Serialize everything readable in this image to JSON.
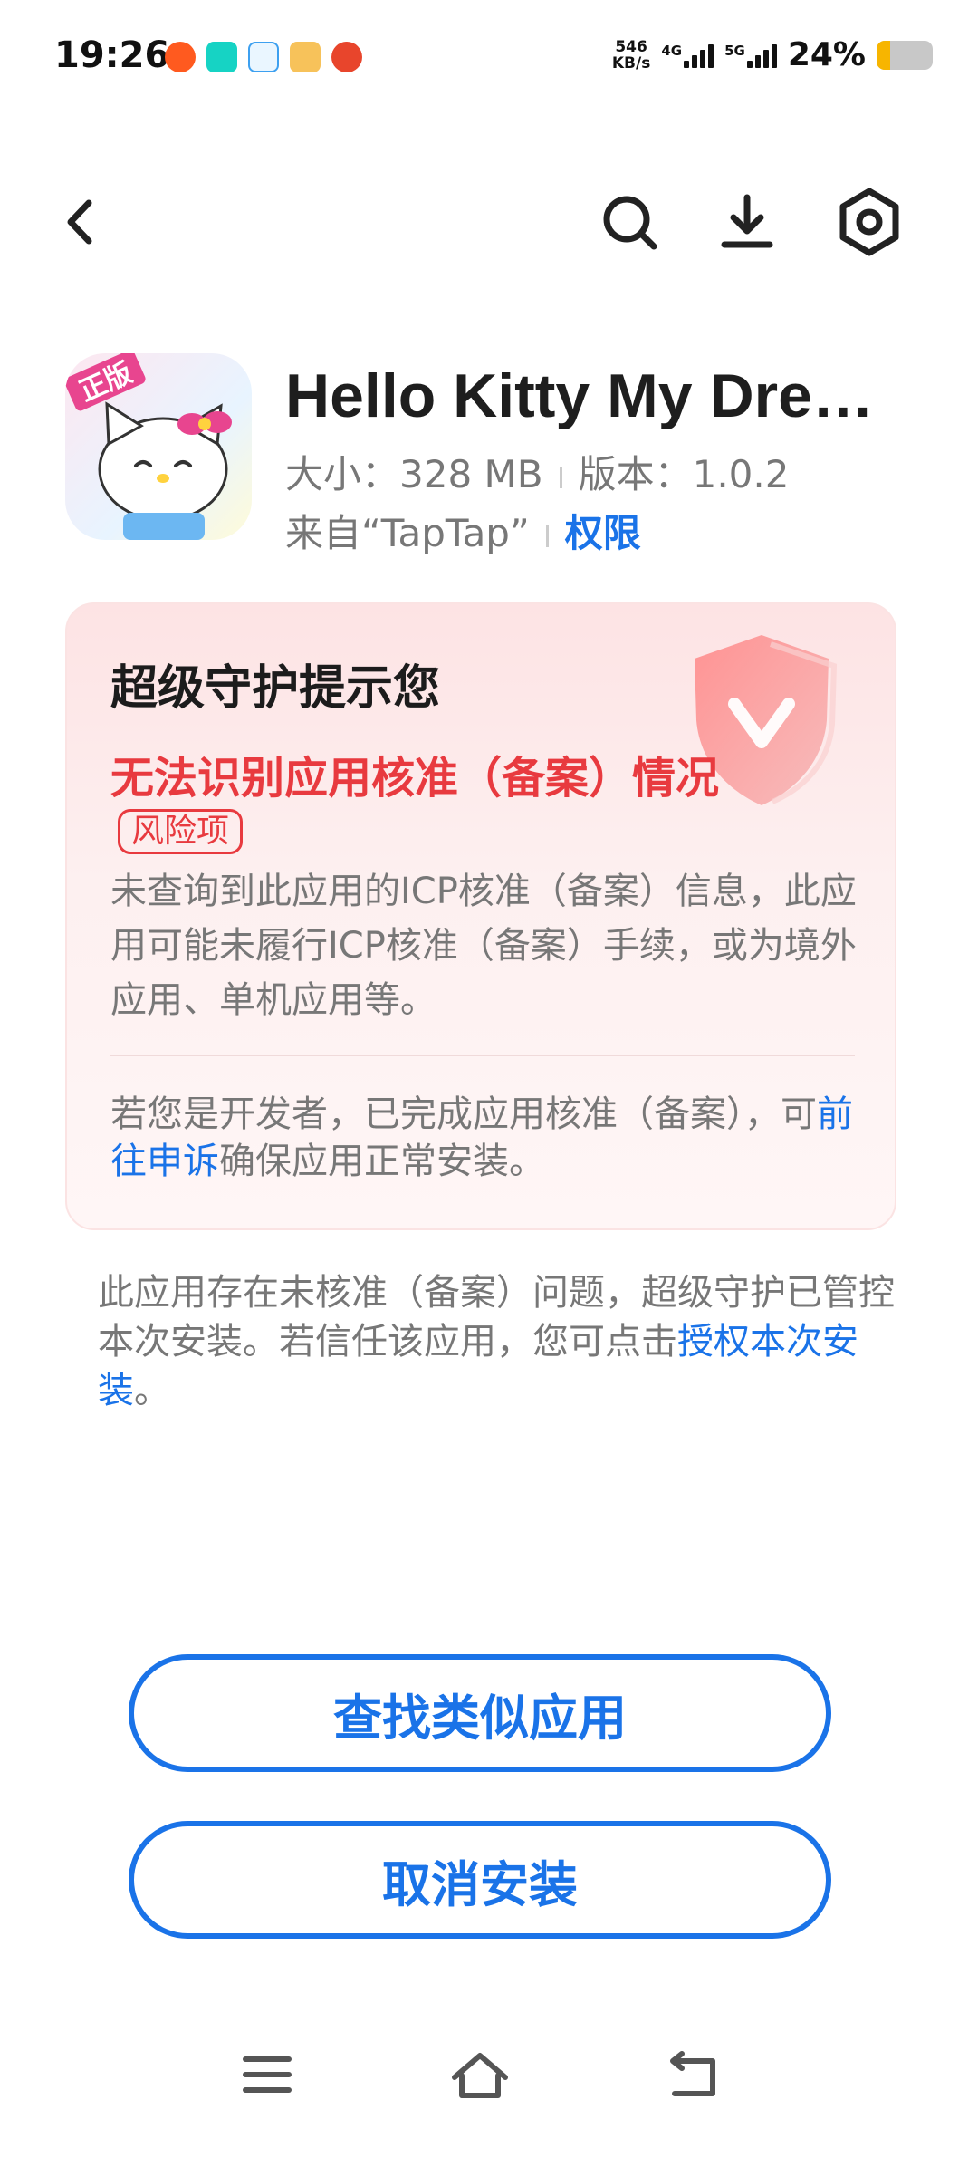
{
  "status_bar": {
    "time": "19:26",
    "net_speed_value": "546",
    "net_speed_unit": "KB/s",
    "network_1": "4G",
    "network_2": "5G",
    "battery_percent": "24%",
    "battery_level": 0.24
  },
  "app": {
    "name": "Hello Kitty My Dre…",
    "icon_badge": "正版",
    "size_label": "大小：",
    "size_value": "328 MB",
    "version_label": "版本：",
    "version_value": "1.0.2",
    "source": "来自“TapTap”",
    "permissions_link": "权限"
  },
  "warning": {
    "title": "超级守护提示您",
    "headline": "无法识别应用核准（备案）情况",
    "risk_badge": "风险项",
    "description": "未查询到此应用的ICP核准（备案）信息，此应用可能未履行ICP核准（备案）手续，或为境外应用、单机应用等。",
    "developer_prefix": "若您是开发者，已完成应用核准（备案），可",
    "developer_link": "前往申诉",
    "developer_suffix": "确保应用正常安装。"
  },
  "notice": {
    "text": "此应用存在未核准（备案）问题，超级守护已管控本次安装。若信任该应用，您可点击",
    "link": "授权本次安装",
    "end": "。"
  },
  "buttons": {
    "find_similar": "查找类似应用",
    "cancel_install": "取消安装"
  },
  "colors": {
    "accent": "#1a73e8",
    "danger": "#e83a3f",
    "battery": "#f7b500"
  }
}
